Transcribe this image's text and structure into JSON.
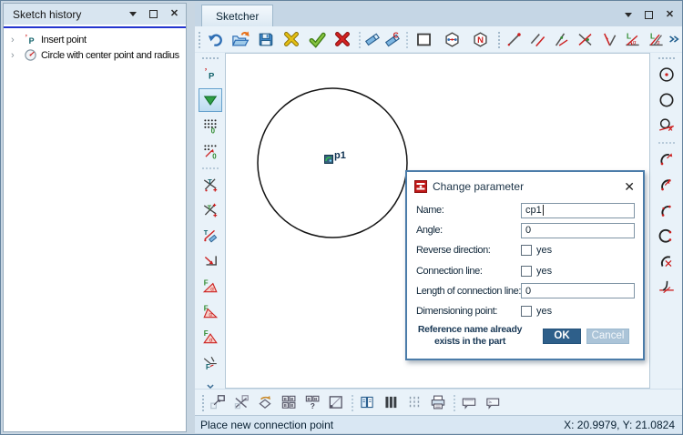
{
  "left_panel": {
    "title": "Sketch history",
    "tree": [
      {
        "icon": "insert-point-icon",
        "label": "Insert point"
      },
      {
        "icon": "circle-radius-icon",
        "label": "Circle with center point and radius"
      }
    ]
  },
  "sketcher": {
    "tab_label": "Sketcher",
    "top_toolbar": [
      "grip",
      "undo-icon",
      "open-icon",
      "save-icon",
      "cancel-x-icon",
      "confirm-check-icon",
      "delete-x-icon",
      "sep",
      "eraser-icon",
      "eraser-c-icon",
      "sep",
      "rectangle-tool-icon",
      "polygon-points-icon",
      "polygon-n-icon",
      "grip",
      "line-icon",
      "parallel-line-icon",
      "line-angle-icon",
      "line-cross-icon",
      "line-bisect-icon",
      "angle-length-icon",
      "angle-length2-icon",
      "more-chevron-icon"
    ],
    "left_toolbar": [
      "hgrip",
      "insert-point-icon",
      "!filter-triangle-icon",
      "point-grid-icon",
      "point-grid-move-icon",
      "hsep",
      "trim-cross-icon",
      "trim-cross-plus-icon",
      "erase-t-icon",
      "corner-arrow-icon",
      "f-angle-1-icon",
      "f-angle-2-icon",
      "f-angle-3-icon",
      "f-corner-icon",
      "chevrons-down-icon"
    ],
    "right_toolbar": [
      "hgrip",
      "circle-center-icon",
      "circle-o-icon",
      "circle-tangent-icon",
      "hsep",
      "arc-arrow-icon",
      "arc-arrow2-icon",
      "arc-dots-icon",
      "arc-dots2-icon",
      "arc-cross-icon",
      "tangent-point-icon"
    ],
    "bottom_toolbar": [
      "grip",
      "zoom-detail-icon",
      "zoom-off-icon",
      "rotate-view-icon",
      "windows-tile-icon",
      "windows-help-icon",
      "zoom-border-icon",
      "sep",
      "redraw-icon",
      "bars-bold-icon",
      "bars-thin-icon",
      "print-icon",
      "sep",
      "panel-a-icon",
      "panel-b-icon"
    ],
    "canvas": {
      "point_label": "p1"
    },
    "status_bar": {
      "message": "Place new connection point",
      "coordinates": "X: 20.9979, Y: 21.0824"
    }
  },
  "dialog": {
    "title": "Change parameter",
    "rows": [
      {
        "label": "Name:",
        "type": "text",
        "value": "cp1",
        "focused": true
      },
      {
        "label": "Angle:",
        "type": "text",
        "value": "0"
      },
      {
        "label": "Reverse direction:",
        "type": "checkbox",
        "checked": false,
        "option": "yes"
      },
      {
        "label": "Connection line:",
        "type": "checkbox",
        "checked": false,
        "option": "yes"
      },
      {
        "label": "Length of connection line:",
        "type": "text",
        "value": "0"
      },
      {
        "label": "Dimensioning point:",
        "type": "checkbox",
        "checked": false,
        "option": "yes"
      }
    ],
    "message": "Reference name already exists in the part",
    "buttons": [
      {
        "label": "OK",
        "primary": true
      },
      {
        "label": "Cancel",
        "primary": false
      }
    ]
  }
}
